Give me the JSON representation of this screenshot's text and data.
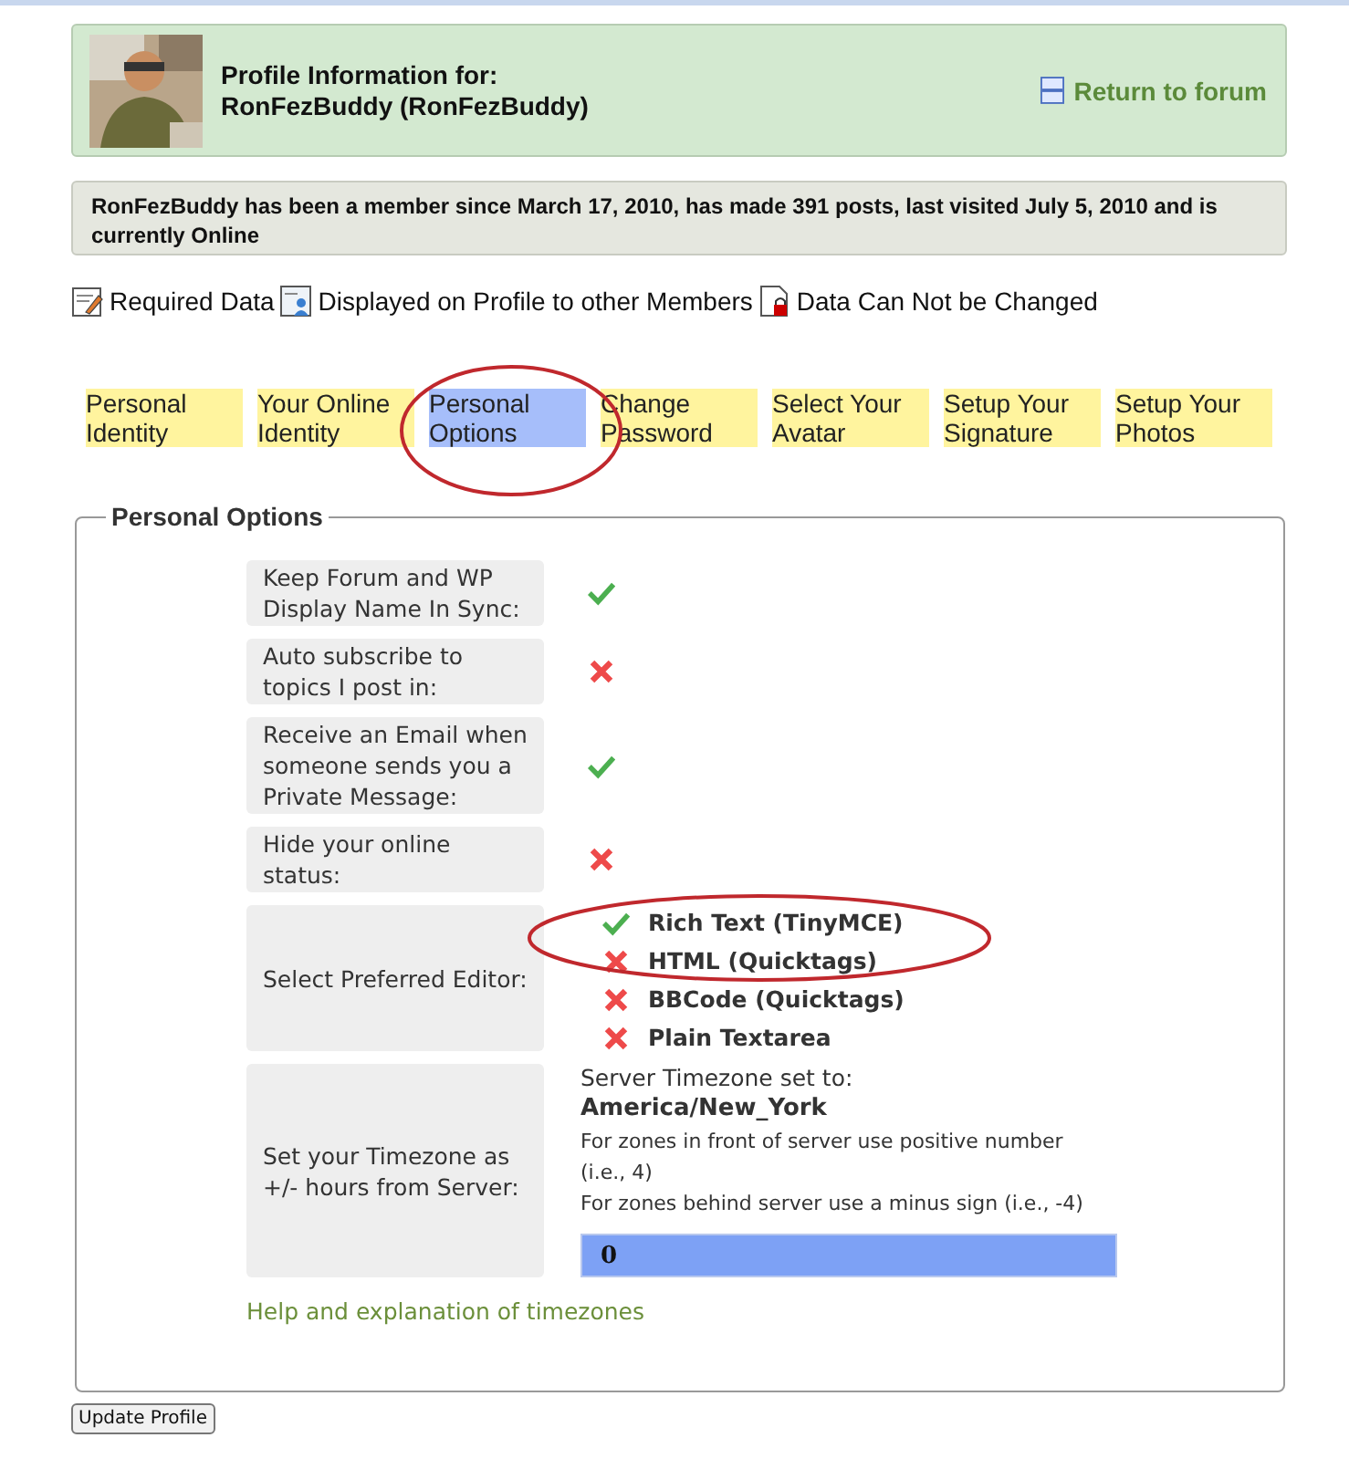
{
  "header": {
    "title": "Profile Information for:",
    "username": "RonFezBuddy (RonFezBuddy)",
    "return_link": "Return to forum"
  },
  "member_info": "RonFezBuddy has been a member since March 17, 2010, has made 391 posts, last visited July 5, 2010 and is currently Online",
  "legend": [
    {
      "kind": "required",
      "label": "Required Data"
    },
    {
      "kind": "displayed",
      "label": "Displayed on Profile to other Members"
    },
    {
      "kind": "locked",
      "label": "Data Can Not be Changed"
    }
  ],
  "tabs": [
    {
      "label": "Personal Identity",
      "selected": false
    },
    {
      "label": "Your Online Identity",
      "selected": false
    },
    {
      "label": "Personal Options",
      "selected": true
    },
    {
      "label": "Change Password",
      "selected": false
    },
    {
      "label": "Select Your Avatar",
      "selected": false
    },
    {
      "label": "Setup Your Signature",
      "selected": false
    },
    {
      "label": "Setup Your Photos",
      "selected": false
    }
  ],
  "section": {
    "title": "Personal Options",
    "rows": [
      {
        "kind": "toggle",
        "label": "Keep Forum and WP Display Name In Sync:",
        "checked": true
      },
      {
        "kind": "toggle",
        "label": "Auto subscribe to topics I post in:",
        "checked": false
      },
      {
        "kind": "toggle",
        "label": "Receive an Email when someone sends you a Private Message:",
        "checked": true
      },
      {
        "kind": "toggle",
        "label": "Hide your online status:",
        "checked": false
      },
      {
        "kind": "editor",
        "label": "Select Preferred Editor:",
        "options": [
          {
            "label": "Rich Text (TinyMCE)",
            "selected": true
          },
          {
            "label": "HTML (Quicktags)",
            "selected": false
          },
          {
            "label": "BBCode (Quicktags)",
            "selected": false
          },
          {
            "label": "Plain Textarea",
            "selected": false
          }
        ]
      },
      {
        "kind": "timezone",
        "label": "Set your Timezone as +/- hours from Server:",
        "server_label": "Server Timezone set to:",
        "server_zone": "America/New_York",
        "hint_ahead": "For zones in front of server use positive number (i.e., 4)",
        "hint_behind": "For zones behind server use a minus sign (i.e., -4)",
        "value": "0"
      }
    ],
    "help_link": "Help and explanation of timezones"
  },
  "submit_button": "Update Profile"
}
